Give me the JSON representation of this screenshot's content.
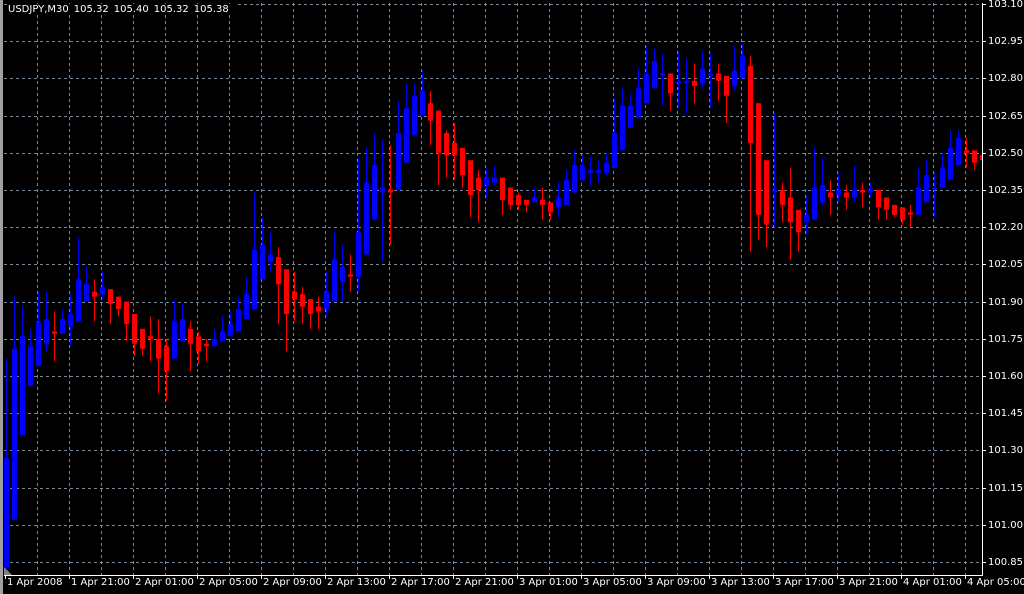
{
  "header": {
    "symbol": "USDJPY,M30",
    "open": "105.32",
    "high": "105.40",
    "low": "105.32",
    "close": "105.38"
  },
  "colors": {
    "background": "#000000",
    "bull": "#0000ff",
    "bear": "#ff0000",
    "grid": "#778899",
    "axis": "#ffffff"
  },
  "chart_data": {
    "type": "candlestick",
    "title": "USDJPY,M30",
    "ylim": [
      100.85,
      103.1
    ],
    "grid": true,
    "y_ticks": [
      "103.10",
      "102.95",
      "102.80",
      "102.65",
      "102.50",
      "102.35",
      "102.20",
      "102.05",
      "101.90",
      "101.75",
      "101.60",
      "101.45",
      "101.30",
      "101.15",
      "101.00",
      "100.85"
    ],
    "x_ticks": [
      "1 Apr 2008",
      "1 Apr 21:00",
      "2 Apr 01:00",
      "2 Apr 05:00",
      "2 Apr 09:00",
      "2 Apr 13:00",
      "2 Apr 17:00",
      "2 Apr 21:00",
      "3 Apr 01:00",
      "3 Apr 05:00",
      "3 Apr 09:00",
      "3 Apr 13:00",
      "3 Apr 17:00",
      "3 Apr 21:00",
      "4 Apr 01:00",
      "4 Apr 05:00"
    ],
    "candles_per_x_tick": 8,
    "ohlc_fields": [
      "open",
      "high",
      "low",
      "close"
    ],
    "candles": [
      [
        100.83,
        101.67,
        100.82,
        101.27
      ],
      [
        101.02,
        101.92,
        101.02,
        101.71
      ],
      [
        101.36,
        101.88,
        101.36,
        101.76
      ],
      [
        101.56,
        101.79,
        101.56,
        101.72
      ],
      [
        101.64,
        101.94,
        101.64,
        101.82
      ],
      [
        101.73,
        101.94,
        101.7,
        101.83
      ],
      [
        101.78,
        101.86,
        101.66,
        101.77
      ],
      [
        101.77,
        101.87,
        101.77,
        101.83
      ],
      [
        101.8,
        101.93,
        101.72,
        101.85
      ],
      [
        101.82,
        102.16,
        101.82,
        101.99
      ],
      [
        101.9,
        102.04,
        101.9,
        101.97
      ],
      [
        101.94,
        101.99,
        101.82,
        101.92
      ],
      [
        101.93,
        102.02,
        101.91,
        101.96
      ],
      [
        101.95,
        101.95,
        101.81,
        101.89
      ],
      [
        101.92,
        101.92,
        101.84,
        101.87
      ],
      [
        101.9,
        101.9,
        101.74,
        101.81
      ],
      [
        101.85,
        101.85,
        101.68,
        101.73
      ],
      [
        101.79,
        101.79,
        101.68,
        101.71
      ],
      [
        101.76,
        101.84,
        101.66,
        101.75
      ],
      [
        101.75,
        101.83,
        101.53,
        101.67
      ],
      [
        101.72,
        101.75,
        101.5,
        101.62
      ],
      [
        101.67,
        101.91,
        101.67,
        101.82
      ],
      [
        101.74,
        101.89,
        101.74,
        101.83
      ],
      [
        101.79,
        101.82,
        101.62,
        101.73
      ],
      [
        101.76,
        101.78,
        101.65,
        101.7
      ],
      [
        101.73,
        101.75,
        101.66,
        101.72
      ],
      [
        101.72,
        101.79,
        101.72,
        101.75
      ],
      [
        101.74,
        101.84,
        101.74,
        101.78
      ],
      [
        101.76,
        101.86,
        101.76,
        101.81
      ],
      [
        101.78,
        101.92,
        101.78,
        101.87
      ],
      [
        101.83,
        102.0,
        101.83,
        101.93
      ],
      [
        101.87,
        102.34,
        101.87,
        102.11
      ],
      [
        101.99,
        102.24,
        101.99,
        102.13
      ],
      [
        102.06,
        102.18,
        102.02,
        102.09
      ],
      [
        102.08,
        102.12,
        101.81,
        101.97
      ],
      [
        102.03,
        102.03,
        101.7,
        101.85
      ],
      [
        101.94,
        102.02,
        101.82,
        101.91
      ],
      [
        101.93,
        101.96,
        101.81,
        101.88
      ],
      [
        101.91,
        101.91,
        101.79,
        101.85
      ],
      [
        101.88,
        101.92,
        101.79,
        101.86
      ],
      [
        101.87,
        102.02,
        101.84,
        101.94
      ],
      [
        101.9,
        102.18,
        101.9,
        102.07
      ],
      [
        101.98,
        102.13,
        101.9,
        102.04
      ],
      [
        102.01,
        102.09,
        101.94,
        102.0
      ],
      [
        102.0,
        102.48,
        101.94,
        102.18
      ],
      [
        102.09,
        102.52,
        102.09,
        102.38
      ],
      [
        102.23,
        102.58,
        102.23,
        102.45
      ],
      [
        102.34,
        102.55,
        102.06,
        102.36
      ],
      [
        102.35,
        102.53,
        102.13,
        102.34
      ],
      [
        102.35,
        102.71,
        102.35,
        102.58
      ],
      [
        102.46,
        102.78,
        102.46,
        102.68
      ],
      [
        102.57,
        102.78,
        102.57,
        102.73
      ],
      [
        102.65,
        102.83,
        102.65,
        102.75
      ],
      [
        102.7,
        102.75,
        102.53,
        102.63
      ],
      [
        102.67,
        102.67,
        102.37,
        102.5
      ],
      [
        102.58,
        102.59,
        102.4,
        102.49
      ],
      [
        102.54,
        102.62,
        102.39,
        102.49
      ],
      [
        102.52,
        102.52,
        102.36,
        102.41
      ],
      [
        102.47,
        102.47,
        102.24,
        102.33
      ],
      [
        102.4,
        102.43,
        102.22,
        102.35
      ],
      [
        102.37,
        102.44,
        102.32,
        102.4
      ],
      [
        102.38,
        102.45,
        102.37,
        102.4
      ],
      [
        102.4,
        102.4,
        102.25,
        102.31
      ],
      [
        102.36,
        102.36,
        102.27,
        102.29
      ],
      [
        102.33,
        102.34,
        102.27,
        102.29
      ],
      [
        102.31,
        102.31,
        102.26,
        102.29
      ],
      [
        102.3,
        102.36,
        102.3,
        102.32
      ],
      [
        102.31,
        102.36,
        102.23,
        102.29
      ],
      [
        102.3,
        102.3,
        102.23,
        102.26
      ],
      [
        102.28,
        102.38,
        102.24,
        102.32
      ],
      [
        102.29,
        102.43,
        102.29,
        102.39
      ],
      [
        102.34,
        102.51,
        102.34,
        102.45
      ],
      [
        102.39,
        102.49,
        102.39,
        102.45
      ],
      [
        102.42,
        102.48,
        102.37,
        102.43
      ],
      [
        102.42,
        102.47,
        102.38,
        102.43
      ],
      [
        102.42,
        102.5,
        102.41,
        102.46
      ],
      [
        102.44,
        102.72,
        102.44,
        102.58
      ],
      [
        102.51,
        102.76,
        102.51,
        102.69
      ],
      [
        102.6,
        102.74,
        102.6,
        102.69
      ],
      [
        102.64,
        102.84,
        102.64,
        102.76
      ],
      [
        102.7,
        102.93,
        102.7,
        102.82
      ],
      [
        102.76,
        102.92,
        102.76,
        102.87
      ],
      [
        102.81,
        102.9,
        102.69,
        102.82
      ],
      [
        102.82,
        102.82,
        102.67,
        102.74
      ],
      [
        102.78,
        102.91,
        102.68,
        102.79
      ],
      [
        102.78,
        102.88,
        102.66,
        102.79
      ],
      [
        102.79,
        102.86,
        102.7,
        102.77
      ],
      [
        102.78,
        102.91,
        102.76,
        102.84
      ],
      [
        102.81,
        102.9,
        102.68,
        102.82
      ],
      [
        102.82,
        102.86,
        102.71,
        102.79
      ],
      [
        102.81,
        102.81,
        102.62,
        102.73
      ],
      [
        102.77,
        102.93,
        102.75,
        102.83
      ],
      [
        102.8,
        102.94,
        102.8,
        102.89
      ],
      [
        102.85,
        102.89,
        102.1,
        102.54
      ],
      [
        102.7,
        102.7,
        102.15,
        102.25
      ],
      [
        102.47,
        102.47,
        102.12,
        102.21
      ],
      [
        102.34,
        102.66,
        102.2,
        102.35
      ],
      [
        102.35,
        102.38,
        102.22,
        102.29
      ],
      [
        102.32,
        102.44,
        102.07,
        102.22
      ],
      [
        102.27,
        102.27,
        102.1,
        102.18
      ],
      [
        102.22,
        102.33,
        102.17,
        102.25
      ],
      [
        102.23,
        102.52,
        102.23,
        102.36
      ],
      [
        102.3,
        102.48,
        102.29,
        102.37
      ],
      [
        102.34,
        102.39,
        102.25,
        102.32
      ],
      [
        102.33,
        102.42,
        102.3,
        102.35
      ],
      [
        102.34,
        102.37,
        102.27,
        102.32
      ],
      [
        102.32,
        102.45,
        102.3,
        102.35
      ],
      [
        102.35,
        102.38,
        102.28,
        102.34
      ],
      [
        102.34,
        102.38,
        102.32,
        102.35
      ],
      [
        102.35,
        102.35,
        102.23,
        102.28
      ],
      [
        102.32,
        102.32,
        102.23,
        102.27
      ],
      [
        102.29,
        102.29,
        102.24,
        102.25
      ],
      [
        102.28,
        102.28,
        102.21,
        102.23
      ],
      [
        102.26,
        102.29,
        102.2,
        102.25
      ],
      [
        102.25,
        102.44,
        102.25,
        102.36
      ],
      [
        102.3,
        102.47,
        102.3,
        102.41
      ],
      [
        102.35,
        102.42,
        102.24,
        102.36
      ],
      [
        102.36,
        102.5,
        102.36,
        102.44
      ],
      [
        102.39,
        102.59,
        102.39,
        102.52
      ],
      [
        102.45,
        102.59,
        102.45,
        102.56
      ],
      [
        102.51,
        102.56,
        102.44,
        102.5
      ],
      [
        102.51,
        102.51,
        102.43,
        102.46
      ],
      [
        102.49,
        102.53,
        102.41,
        102.47
      ]
    ]
  }
}
